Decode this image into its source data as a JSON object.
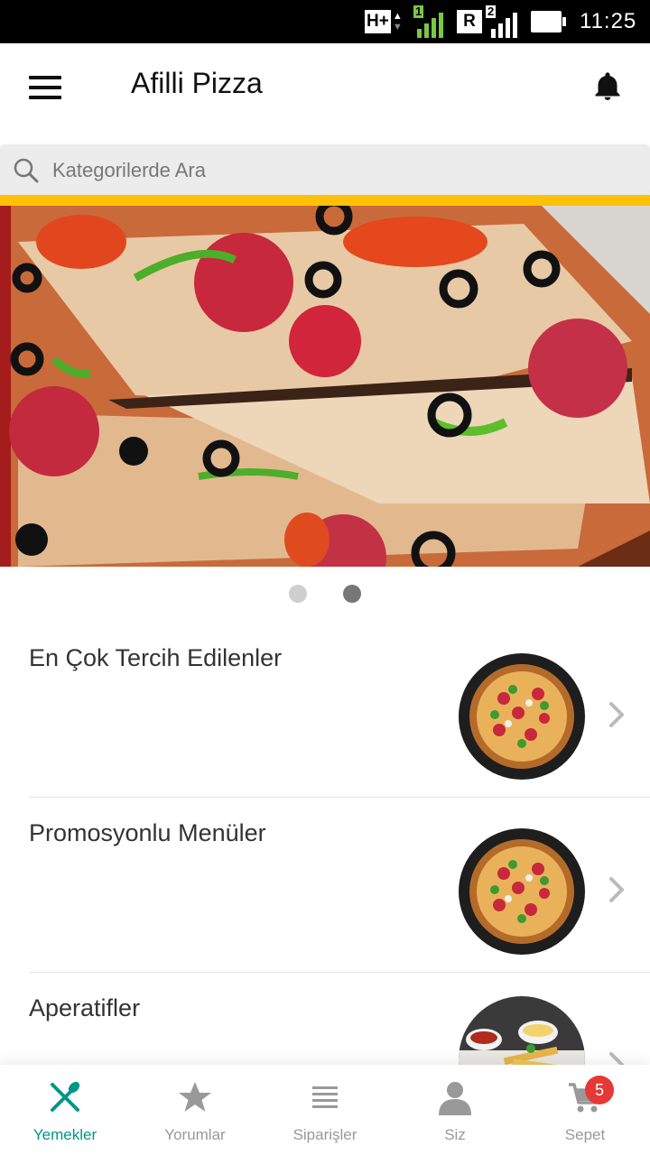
{
  "status_bar": {
    "network_type": "H+",
    "sim1_label": "1",
    "roaming_label": "R",
    "sim2_label": "2",
    "time": "11:25"
  },
  "app": {
    "title": "Afilli Pizza",
    "icons": {
      "menu": "hamburger-icon",
      "notifications": "bell-icon"
    }
  },
  "search": {
    "placeholder": "Kategorilerde Ara",
    "value": "",
    "icon": "search-icon"
  },
  "banner": {
    "image": "pizza-slices-photo",
    "carousel_pages": 2,
    "active_page": 2
  },
  "categories": [
    {
      "title": "En Çok Tercih Edilenler",
      "image": "pizza-thumbnail"
    },
    {
      "title": "Promosyonlu Menüler",
      "image": "pizza-thumbnail"
    },
    {
      "title": "Aperatifler",
      "image": "appetizers-thumbnail"
    }
  ],
  "bottom_nav": {
    "items": [
      {
        "label": "Yemekler",
        "icon": "fork-knife-icon",
        "active": true
      },
      {
        "label": "Yorumlar",
        "icon": "star-icon",
        "active": false
      },
      {
        "label": "Siparişler",
        "icon": "list-icon",
        "active": false
      },
      {
        "label": "Siz",
        "icon": "person-icon",
        "active": false
      },
      {
        "label": "Sepet",
        "icon": "cart-icon",
        "active": false
      }
    ],
    "cart_count": "5"
  },
  "colors": {
    "accent": "#009688",
    "highlight_bar": "#ffc107",
    "badge": "#e53935",
    "inactive": "#999999"
  }
}
